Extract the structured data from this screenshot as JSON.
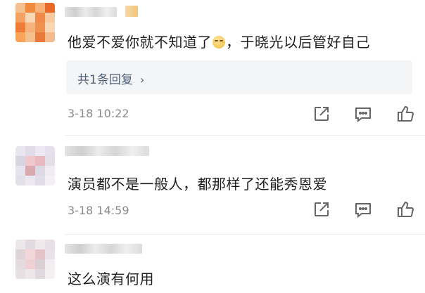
{
  "comments": [
    {
      "text_before_emoji": "他爱不爱你就不知道了",
      "emoji": "smile-emoji",
      "text_after_emoji": "，于晓光以后管好自己",
      "reply_label": "共1条回复",
      "timestamp": "3-18 10:22"
    },
    {
      "text": "演员都不是一般人，都那样了还能秀恩爱",
      "timestamp": "3-18 14:59"
    },
    {
      "text": "这么演有何用"
    }
  ],
  "icons": {
    "share": "share-icon",
    "comment": "comment-icon",
    "like": "like-icon"
  },
  "colors": {
    "reply_link": "#4e5f78",
    "timestamp": "#8a8a8a",
    "icon": "#666666"
  }
}
